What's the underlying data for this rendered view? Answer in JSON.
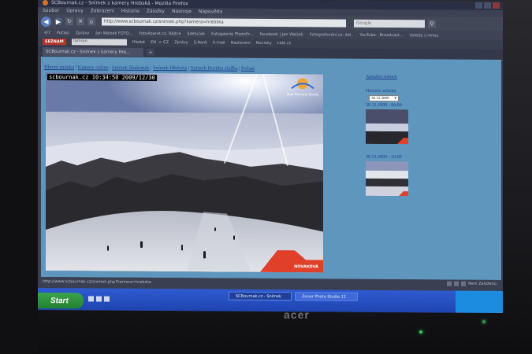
{
  "window": {
    "title": "SCBournak.cz - Snímek z kamery Hrebská - Mozilla Firefox"
  },
  "menu": [
    "Soubor",
    "Úpravy",
    "Zobrazení",
    "Historie",
    "Záložky",
    "Nástroje",
    "Nápověda"
  ],
  "nav": {
    "url": "http://www.scbournak.cz/snimek.php?kamera=hrebska",
    "search_placeholder": "Google"
  },
  "bookmarks": [
    "4/7",
    "Počasí",
    "Zprávy",
    "Jan Walzek FOTO...",
    "FotoAparat.cz, Rádce",
    "Sdeluček",
    "Fotogalerie PhotoEr...",
    "Facebook | Jan Walzek",
    "Fotografování.cz: dal..",
    "YouTube - Broadcast...",
    "Volejte s mnou"
  ],
  "toolbar2": {
    "brand": "SEZNAM",
    "search_value": "tamron",
    "items": [
      "Hledat",
      "EN -> CZ",
      "Zprávy",
      "S.Rank",
      "E-mail",
      "Nastavení",
      "Novinky",
      "Lidé.cz"
    ]
  },
  "tab": {
    "label": "SCBournak.cz - Snímek z kamery Hre..."
  },
  "page": {
    "topnav": [
      "Hlavní stránka",
      "Kamery online",
      "Snímek Sbalomák",
      "Snímek Hřebská",
      "Snímek Horitka služba",
      "Počasí"
    ],
    "timestamp": "scbournak.cz   10:34:50  2009/12/30",
    "logo_text": "Sion Cervena Bouda",
    "brandmark": "NOVAKOVÁ",
    "side": {
      "current_link": "Aktuální snímek",
      "history_label": "Historie snímků",
      "date_select": "30.12.2009",
      "caption1": "30.12.2009 - 08:00",
      "caption2": "30.12.2009 - 10:00"
    }
  },
  "status": {
    "text": "http://www.scbournak.cz/snimek.php?kamera=hrebska",
    "right": "Není Založeno"
  },
  "taskbar": {
    "start": "Start",
    "tasks": [
      "SCBournak.cz - Snímek",
      "Zoner Photo Studio 11"
    ]
  },
  "bezel": {
    "brand": "acer"
  }
}
